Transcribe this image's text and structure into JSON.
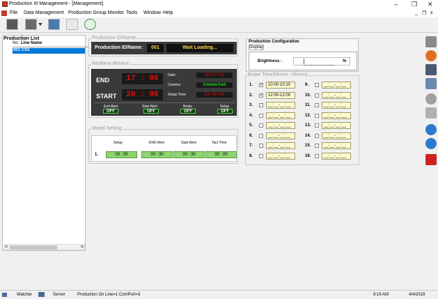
{
  "window": {
    "title": "Production III Management - [Management]",
    "minimize": "–",
    "maximize": "❐",
    "close": "✕",
    "child_min": "_",
    "child_restore": "❐",
    "child_close": "x"
  },
  "menu": {
    "items": [
      "File",
      "Data Management",
      "Production Group Monitor",
      "Tools",
      "Window",
      "Help"
    ]
  },
  "production_list": {
    "title": "Production List",
    "col_no": "No.",
    "col_name": "Line Name",
    "rows": [
      {
        "no": "001",
        "name": "CS1"
      }
    ],
    "scroll_left": "<",
    "scroll_right": ">"
  },
  "production_id": {
    "group_label": "Production ID/Name",
    "label": "Production ID/Name:",
    "id_value": "001",
    "name_value": "Wait Loading..."
  },
  "realtime": {
    "group_label": "Realtime Monitor",
    "end_label": "END",
    "end_time": "17 : 00",
    "start_label": "START",
    "start_time": "20 : 00",
    "date_label": "Date:",
    "date_value": "30/07/61",
    "commu_label": "Commu:",
    "commu_value": "Connected",
    "setup_label": "Setup Time:",
    "setup_value": "03:00:00",
    "alerts": [
      {
        "label": "End Alert",
        "value": "OFF"
      },
      {
        "label": "Start Alert",
        "value": "OFF"
      },
      {
        "label": "Brake",
        "value": "OFF"
      },
      {
        "label": "Setup",
        "value": "OFF"
      }
    ]
  },
  "model_setting": {
    "group_label": "Model Setting",
    "headers": [
      "Setup",
      "END Alert",
      "Start Alert",
      "Tact Time"
    ],
    "row_no": "1.",
    "row_values": [
      "03 : 00",
      "00 : 30",
      "00 : 30",
      "00 : 00"
    ]
  },
  "production_config": {
    "title": "Production Configuration",
    "display_btn": "Display",
    "brightness_label": "Brightness :",
    "brightness_unit": "%"
  },
  "brake_time": {
    "group_label": "Brake Time(hhmm - hhmm)",
    "left": [
      {
        "no": "1.",
        "checked": true,
        "value": "10:00-10:10"
      },
      {
        "no": "2.",
        "checked": true,
        "value": "12:00-12:00"
      },
      {
        "no": "3.",
        "checked": false,
        "value": "__:__-__:__"
      },
      {
        "no": "4.",
        "checked": false,
        "value": "__:__-__:__"
      },
      {
        "no": "5.",
        "checked": false,
        "value": "__:__-__:__"
      },
      {
        "no": "6.",
        "checked": false,
        "value": "__:__-__:__"
      },
      {
        "no": "7.",
        "checked": false,
        "value": "__:__-__:__"
      },
      {
        "no": "8.",
        "checked": false,
        "value": "__:__-__:__"
      }
    ],
    "right": [
      {
        "no": "9.",
        "checked": false,
        "value": "__:__-__:__"
      },
      {
        "no": "10.",
        "checked": false,
        "value": "__:__-__:__"
      },
      {
        "no": "11.",
        "checked": false,
        "value": "__:__-__:__"
      },
      {
        "no": "12.",
        "checked": false,
        "value": "__:__-__:__"
      },
      {
        "no": "13.",
        "checked": false,
        "value": "__:__-__:__"
      },
      {
        "no": "14.",
        "checked": false,
        "value": "__:__-__:__"
      },
      {
        "no": "15.",
        "checked": false,
        "value": "__:__-__:__"
      },
      {
        "no": "16.",
        "checked": false,
        "value": "__:__-__:__"
      }
    ]
  },
  "statusbar": {
    "watcher": "Watcher",
    "server": "Server",
    "info": "Production On Line=1 ComPort=3",
    "time": "9:19 AM",
    "date": "4/4/2019"
  },
  "colors": {
    "led_red": "#e01010",
    "connected_green": "#20e020",
    "model_green": "#8cd46c",
    "brake_yellow": "#fffad0",
    "selected_blue": "#0078d7"
  }
}
